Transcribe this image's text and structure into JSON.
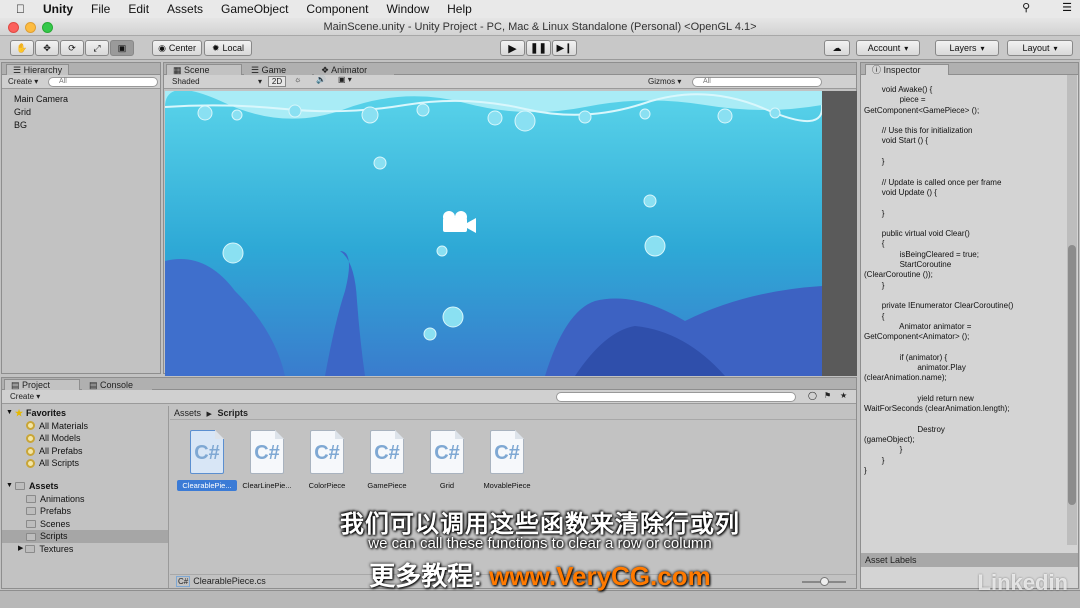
{
  "menubar": {
    "app": "Unity",
    "items": [
      "File",
      "Edit",
      "Assets",
      "GameObject",
      "Component",
      "Window",
      "Help"
    ]
  },
  "window": {
    "title": "MainScene.unity - Unity Project - PC, Mac & Linux Standalone (Personal) <OpenGL 4.1>"
  },
  "toolbar": {
    "pivot": "Center",
    "space": "Local",
    "account": "Account",
    "layers": "Layers",
    "layout": "Layout"
  },
  "hierarchy": {
    "tab": "Hierarchy",
    "create": "Create",
    "search_placeholder": "All",
    "items": [
      "Main Camera",
      "Grid",
      "BG"
    ]
  },
  "scene": {
    "tabs": [
      "Scene",
      "Game",
      "Animator"
    ],
    "shading": "Shaded",
    "mode2d": "2D",
    "gizmos": "Gizmos",
    "search_placeholder": "All"
  },
  "inspector": {
    "tab": "Inspector",
    "asset_labels": "Asset Labels",
    "code": "        void Awake() {\n                piece =\nGetComponent<GamePiece> ();\n\n        // Use this for initialization\n        void Start () {\n\n        }\n\n        // Update is called once per frame\n        void Update () {\n\n        }\n\n        public virtual void Clear()\n        {\n                isBeingCleared = true;\n                StartCoroutine\n(ClearCoroutine ());\n        }\n\n        private IEnumerator ClearCoroutine()\n        {\n                Animator animator =\nGetComponent<Animator> ();\n\n                if (animator) {\n                        animator.Play\n(clearAnimation.name);\n\n                        yield return new\nWaitForSeconds (clearAnimation.length);\n\n                        Destroy\n(gameObject);\n                }\n        }\n}"
  },
  "project": {
    "tabs": [
      "Project",
      "Console"
    ],
    "create": "Create",
    "favorites": {
      "label": "Favorites",
      "items": [
        "All Materials",
        "All Models",
        "All Prefabs",
        "All Scripts"
      ]
    },
    "assets": {
      "label": "Assets",
      "items": [
        "Animations",
        "Prefabs",
        "Scenes",
        "Scripts",
        "Textures"
      ]
    },
    "breadcrumb": [
      "Assets",
      "Scripts"
    ],
    "files": [
      "ClearablePie...",
      "ClearLinePie...",
      "ColorPiece",
      "GamePiece",
      "Grid",
      "MovablePiece"
    ],
    "status_file": "ClearablePiece.cs"
  },
  "subtitles": {
    "cn": "我们可以调用这些函数来清除行或列",
    "en": "we can call these functions to clear a row or column",
    "promo_label": "更多教程:",
    "promo_url": "www.VeryCG.com"
  },
  "watermark": "Linkedin",
  "colors": {
    "sea_top": "#5ad4ea",
    "sea_mid": "#2ea9d6",
    "sea_bottom": "#3a5fc2",
    "selection": "#3b7bd6",
    "promo_url": "#ff7a00"
  }
}
